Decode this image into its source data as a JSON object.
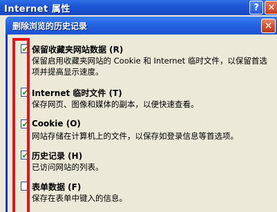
{
  "outer_window": {
    "title": "Internet 属性",
    "help_label": "?",
    "close_label": "✕"
  },
  "dialog": {
    "title": "删除浏览的历史记录",
    "close_label": "✕"
  },
  "options": [
    {
      "label": "保留收藏夹网站数据 (R)",
      "checked": true,
      "description": "保留启用收藏夹网站的 Cookie 和 Internet 临时文件，以保留首选项并提高显示速度。"
    },
    {
      "label": "Internet 临时文件 (T)",
      "checked": true,
      "description": "保存网页、图像和媒体的副本，以便快速查看。"
    },
    {
      "label": "Cookie (O)",
      "checked": true,
      "description": "网站存储在计算机上的文件，以保存如登录信息等首选项。"
    },
    {
      "label": "历史记录 (H)",
      "checked": true,
      "description": "已访问网站的列表。"
    },
    {
      "label": "表单数据 (F)",
      "checked": false,
      "description": "保存在表单中键入的信息。"
    }
  ],
  "colors": {
    "annotation": "#e4141a",
    "titlebar": "#2463e3",
    "dialog_bg": "#ece9d8",
    "check": "#21a121"
  },
  "icons": {
    "check": "✔"
  }
}
